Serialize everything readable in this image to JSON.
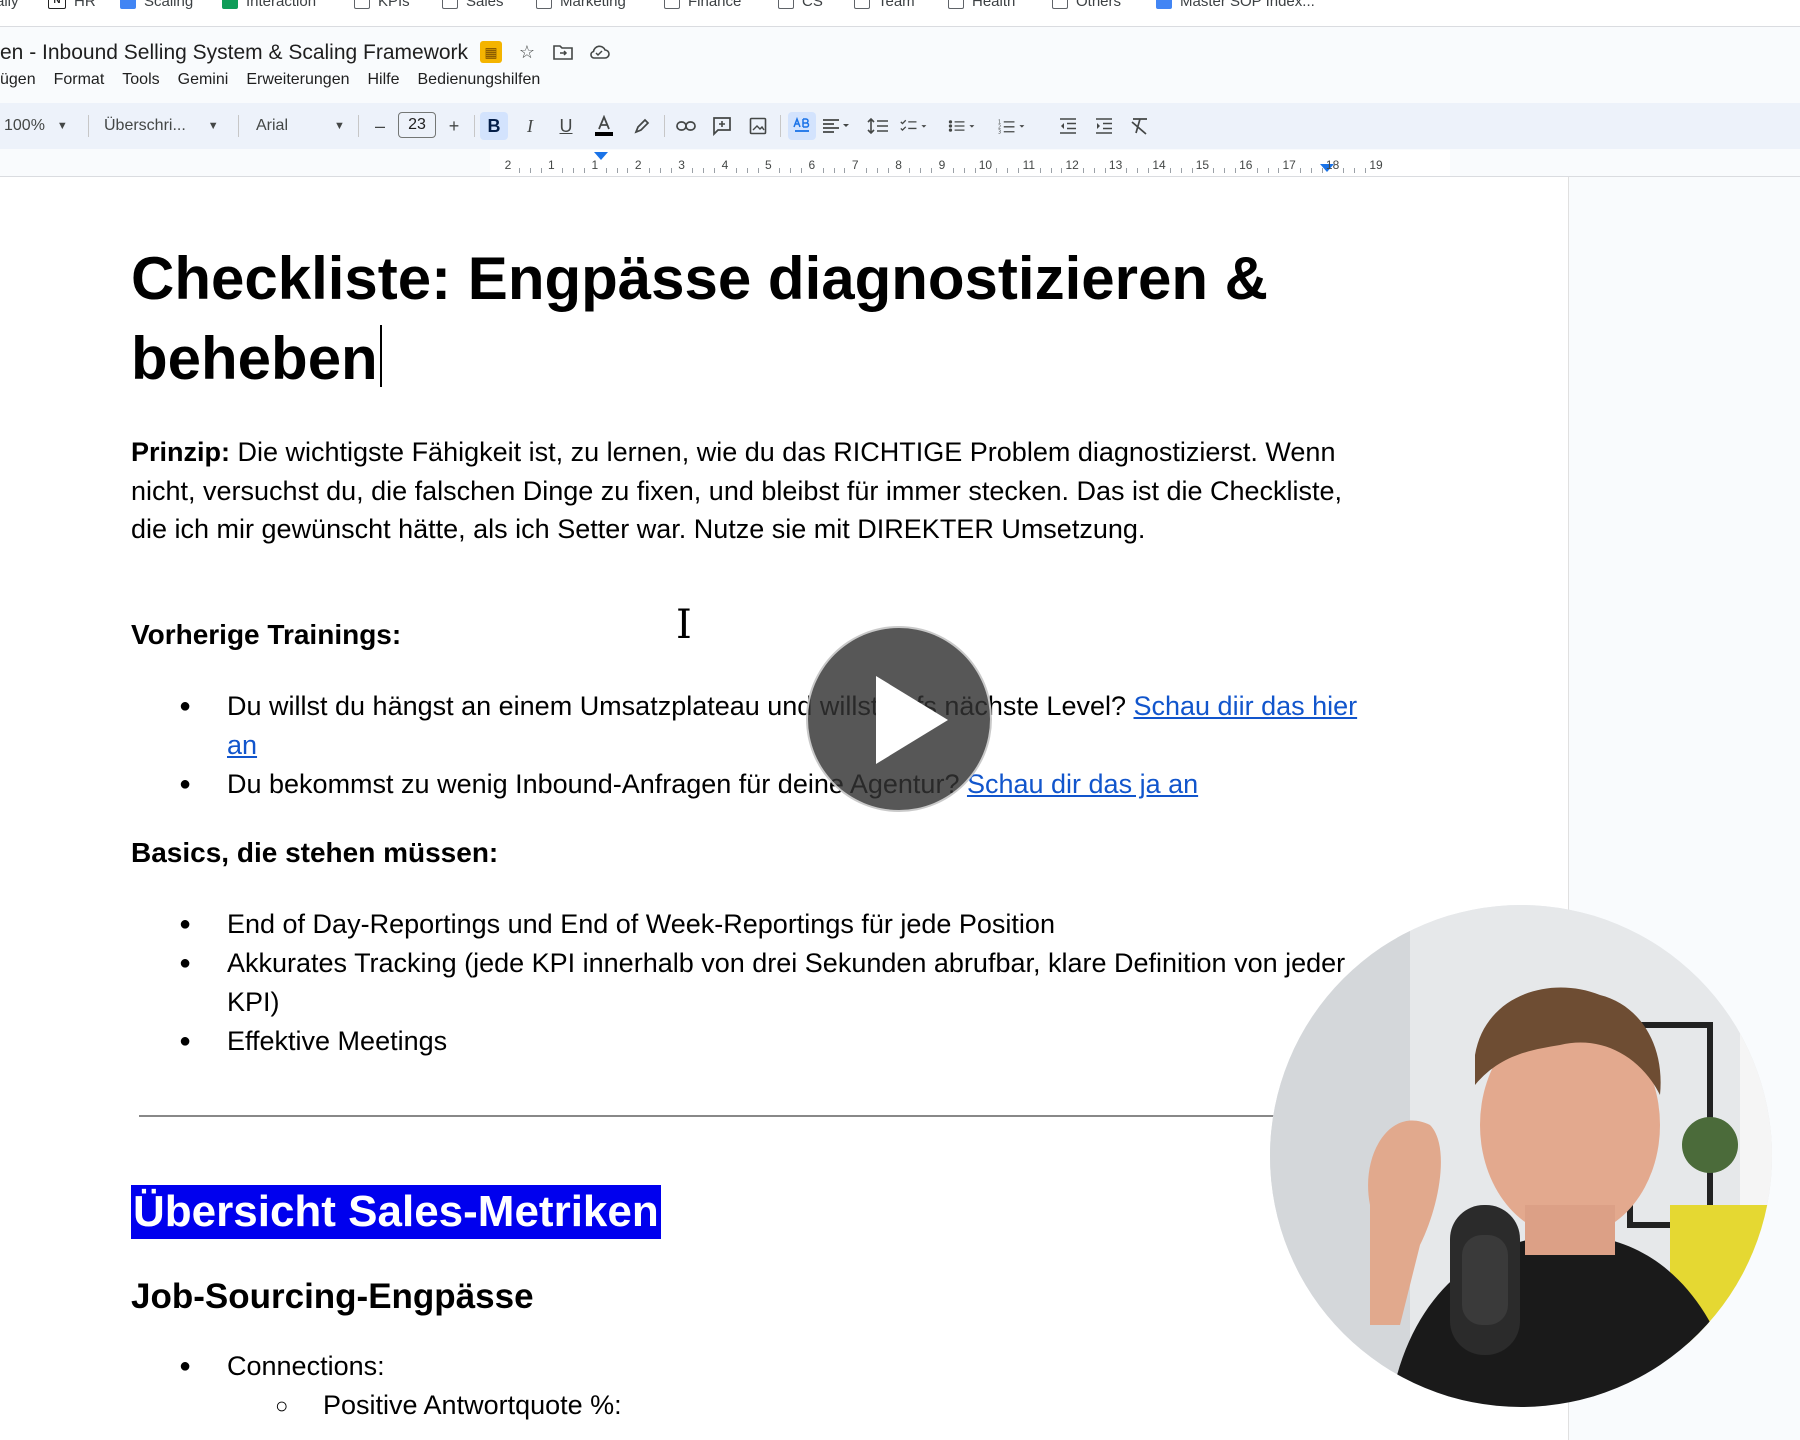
{
  "bookmarks": [
    {
      "label": "aily",
      "icon": "none"
    },
    {
      "label": "HR",
      "icon": "notion"
    },
    {
      "label": "Scaling",
      "icon": "doc"
    },
    {
      "label": "Interaction",
      "icon": "sheet"
    },
    {
      "label": "KPIs",
      "icon": "folder"
    },
    {
      "label": "Sales",
      "icon": "folder"
    },
    {
      "label": "Marketing",
      "icon": "folder"
    },
    {
      "label": "Finance",
      "icon": "folder"
    },
    {
      "label": "CS",
      "icon": "folder"
    },
    {
      "label": "Team",
      "icon": "folder"
    },
    {
      "label": "Health",
      "icon": "folder"
    },
    {
      "label": "Others",
      "icon": "folder"
    },
    {
      "label": "Master SOP Index...",
      "icon": "doc"
    }
  ],
  "document": {
    "title": "en - Inbound Selling System & Scaling Framework"
  },
  "menu": [
    "ügen",
    "Format",
    "Tools",
    "Gemini",
    "Erweiterungen",
    "Hilfe",
    "Bedienungshilfen"
  ],
  "toolbar": {
    "zoom": "100%",
    "style": "Überschri...",
    "font": "Arial",
    "font_size": "23",
    "minus": "–",
    "plus": "+"
  },
  "ruler": {
    "ticks": [
      "2",
      "1",
      "1",
      "2",
      "3",
      "4",
      "5",
      "6",
      "7",
      "8",
      "9",
      "10",
      "11",
      "12",
      "13",
      "14",
      "15",
      "16",
      "17",
      "18",
      "19"
    ]
  },
  "content": {
    "h1_line1": "Checkliste: Engpässe diagnostizieren &",
    "h1_line2": "beheben",
    "principle_label": "Prinzip:",
    "principle_text": " Die wichtigste Fähigkeit ist, zu lernen, wie du das RICHTIGE Problem diagnostizierst. Wenn nicht, versuchst du, die falschen Dinge zu fixen, und bleibst für immer stecken. Das ist die Checkliste, die ich mir gewünscht hätte, als ich Setter war. Nutze sie mit DIREKTER Umsetzung.",
    "prev_heading": "Vorherige Trainings:",
    "prev_items": [
      {
        "text": "Du willst du hängst an einem Umsatzplateau und willst aufs nächste Level? ",
        "link": "Schau diir das hier an"
      },
      {
        "text": "Du bekommst zu wenig Inbound-Anfragen für deine Agentur? ",
        "link": "Schau dir das ja an"
      }
    ],
    "basics_heading": "Basics, die stehen müssen:",
    "basics_items": [
      "End of Day-Reportings und End of Week-Reportings für jede Position",
      "Akkurates Tracking (jede KPI innerhalb von drei Sekunden abrufbar, klare Definition von jeder KPI)",
      "Effektive Meetings"
    ],
    "highlight_heading": "Übersicht Sales-Metriken",
    "job_heading": "Job-Sourcing-Engpässe",
    "job_items": [
      {
        "text": "Connections:",
        "level": 1
      },
      {
        "text": "Positive Antwortquote %:",
        "level": 2
      }
    ]
  },
  "colors": {
    "accent": "#1a73e8",
    "link": "#1155cc",
    "highlight": "#0000ee",
    "toolbar_bg": "#edf2fa"
  }
}
